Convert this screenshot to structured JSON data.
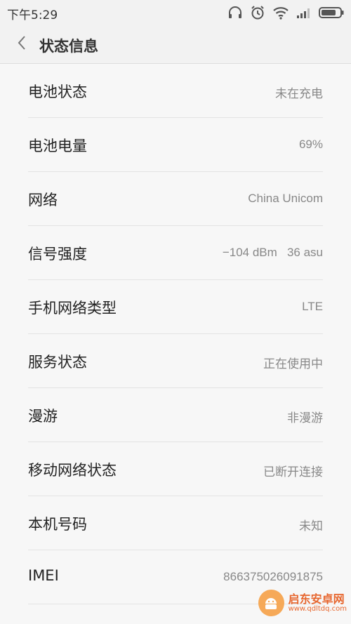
{
  "status_bar": {
    "time": "下午5:29",
    "icons": [
      "headphones-icon",
      "alarm-icon",
      "wifi-icon",
      "signal-icon",
      "battery-icon"
    ]
  },
  "header": {
    "back_icon": "chevron-left-icon",
    "title": "状态信息"
  },
  "rows": [
    {
      "label": "电池状态",
      "value": "未在充电"
    },
    {
      "label": "电池电量",
      "value": "69%"
    },
    {
      "label": "网络",
      "value": "China Unicom"
    },
    {
      "label": "信号强度",
      "value": "−104 dBm   36 asu"
    },
    {
      "label": "手机网络类型",
      "value": "LTE"
    },
    {
      "label": "服务状态",
      "value": "正在使用中"
    },
    {
      "label": "漫游",
      "value": "非漫游"
    },
    {
      "label": "移动网络状态",
      "value": "已断开连接"
    },
    {
      "label": "本机号码",
      "value": "未知"
    },
    {
      "label": "IMEI",
      "value": "866375026091875"
    }
  ],
  "watermark": {
    "name": "启东安卓网",
    "url": "www.qdltdq.com"
  },
  "colors": {
    "background": "#f7f7f7",
    "label": "#222222",
    "value": "#888888",
    "divider": "#e3e3e3",
    "watermark": "#e65a1d"
  }
}
